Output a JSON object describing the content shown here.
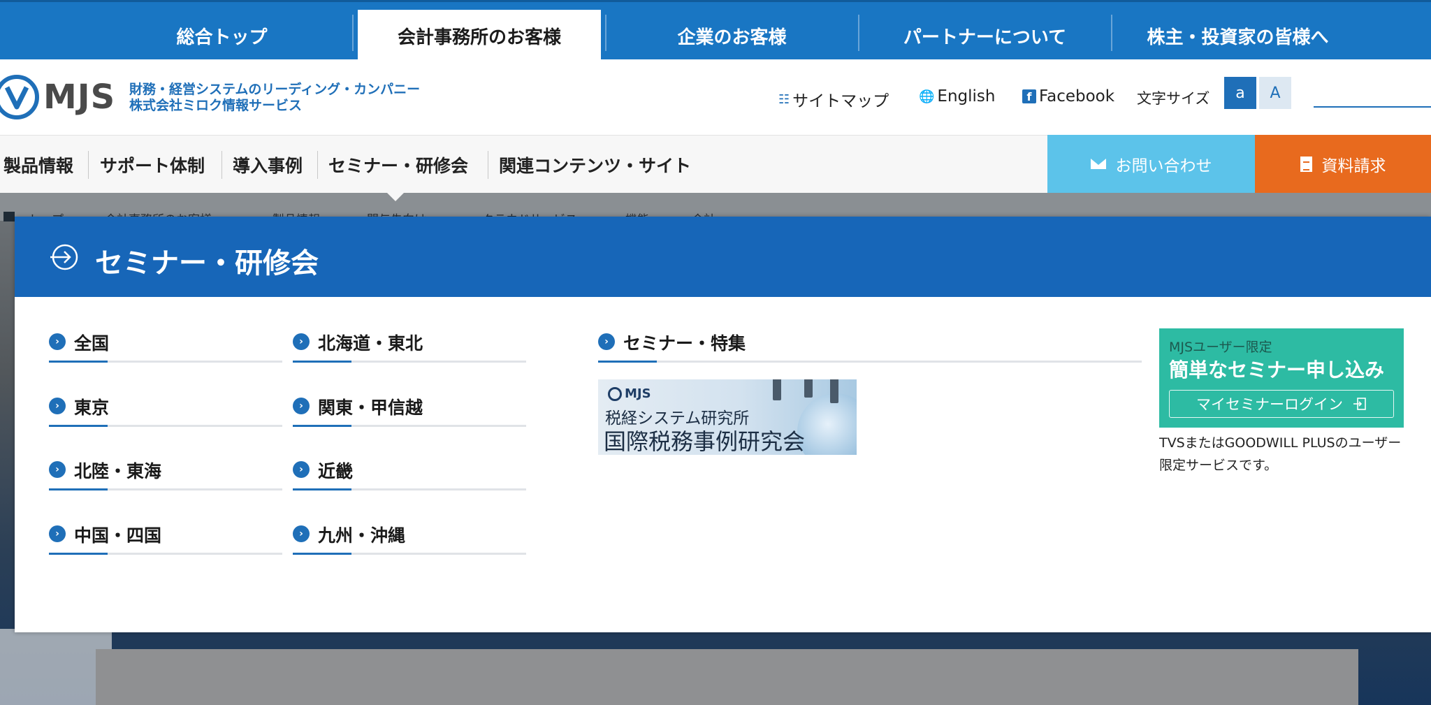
{
  "top_nav": {
    "tabs": [
      {
        "label": "総合トップ"
      },
      {
        "label": "会計事務所のお客様"
      },
      {
        "label": "企業のお客様"
      },
      {
        "label": "パートナーについて"
      },
      {
        "label": "株主・投資家の皆様へ"
      }
    ],
    "active_index": 1
  },
  "header": {
    "logo_text": "MJS",
    "tagline_line1": "財務・経営システムのリーディング・カンパニー",
    "tagline_line2": "株式会社ミロク情報サービス",
    "links": {
      "sitemap": "サイトマップ",
      "english": "English",
      "facebook": "Facebook"
    },
    "font_size_label": "文字サイズ",
    "font_size_small": "a",
    "font_size_large": "A"
  },
  "sub_nav": {
    "items": [
      {
        "label": "製品情報"
      },
      {
        "label": "サポート体制"
      },
      {
        "label": "導入事例"
      },
      {
        "label": "セミナー・研修会"
      },
      {
        "label": "関連コンテンツ・サイト"
      }
    ],
    "contact_label": "お問い合わせ",
    "docs_label": "資料請求"
  },
  "breadcrumb": {
    "items": [
      "トップ",
      "会計事務所のお客様",
      "製品情報",
      "関与先向け",
      "クラウドサービス",
      "機能",
      "会計"
    ]
  },
  "mega_panel": {
    "title": "セミナー・研修会",
    "regions_col1": [
      {
        "label": "全国"
      },
      {
        "label": "東京"
      },
      {
        "label": "北陸・東海"
      },
      {
        "label": "中国・四国"
      }
    ],
    "regions_col2": [
      {
        "label": "北海道・東北"
      },
      {
        "label": "関東・甲信越"
      },
      {
        "label": "近畿"
      },
      {
        "label": "九州・沖縄"
      }
    ],
    "feature": {
      "label": "セミナー・特集",
      "banner_brand": "MJS",
      "banner_line1": "税経システム研究所",
      "banner_line2": "国際税務事例研究会"
    },
    "promo": {
      "small": "MJSユーザー限定",
      "big": "簡単なセミナー申し込み",
      "button": "マイセミナーログイン",
      "note": "TVSまたはGOODWILL PLUSのユーザー限定サービスです。"
    }
  },
  "colors": {
    "brand_blue": "#1976c3",
    "panel_blue": "#1766b8",
    "contact_cyan": "#5cc3ea",
    "docs_orange": "#e86a1e",
    "promo_teal": "#2dbba3"
  },
  "icons": {
    "sitemap": "sitemap-icon",
    "english": "globe-icon",
    "facebook": "facebook-icon",
    "contact": "mail-icon",
    "docs": "document-icon",
    "panel": "arrow-circle-icon",
    "bullet": "chevron-circle-icon",
    "login": "login-icon"
  }
}
